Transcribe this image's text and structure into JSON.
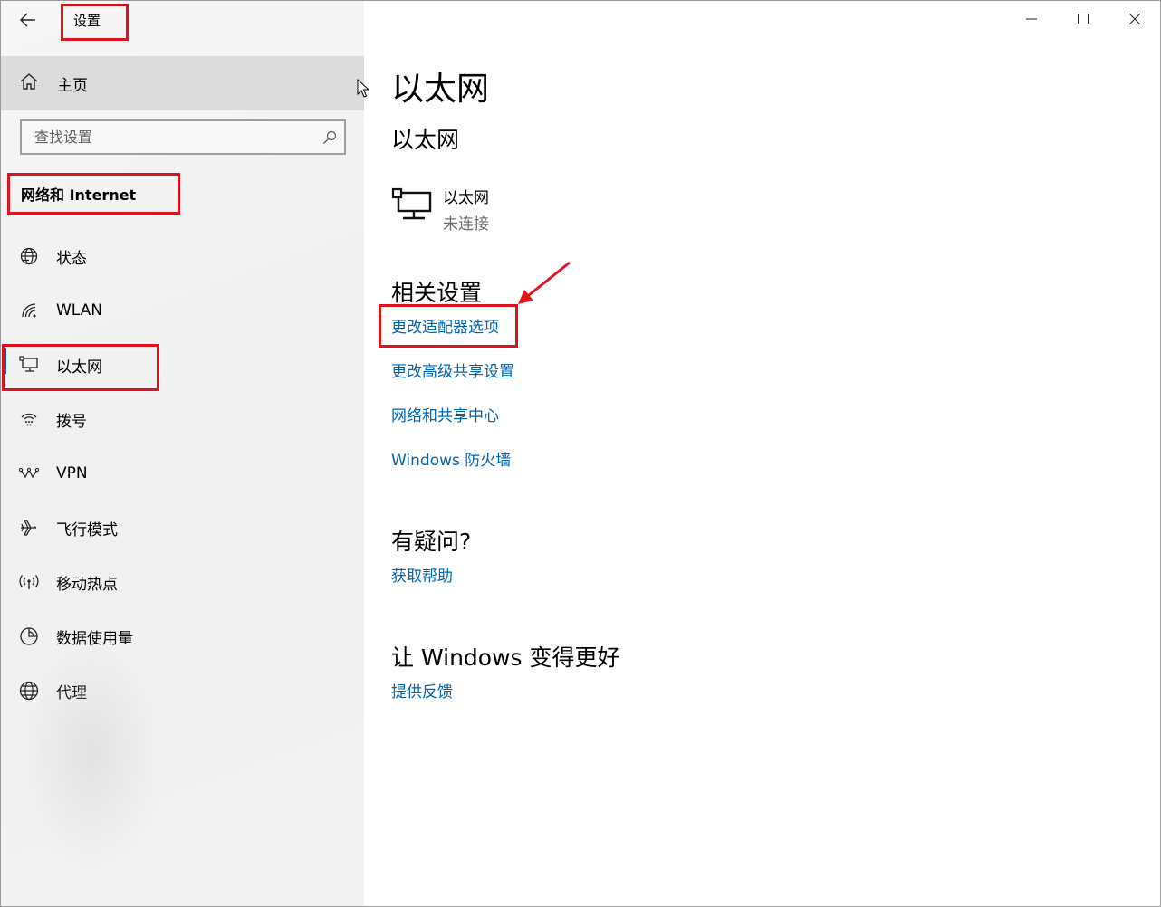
{
  "window": {
    "title": "设置",
    "controls": {
      "minimize": "minimize-icon",
      "maximize": "maximize-icon",
      "close": "close-icon"
    }
  },
  "sidebar": {
    "back_icon": "back-arrow-icon",
    "home": {
      "label": "主页",
      "icon": "home-icon"
    },
    "search": {
      "placeholder": "查找设置",
      "value": "",
      "icon": "search-icon"
    },
    "section_title": "网络和 Internet",
    "items": [
      {
        "label": "状态",
        "icon": "globe-status-icon",
        "selected": false
      },
      {
        "label": "WLAN",
        "icon": "wifi-icon",
        "selected": false
      },
      {
        "label": "以太网",
        "icon": "ethernet-icon",
        "selected": true
      },
      {
        "label": "拨号",
        "icon": "dialup-icon",
        "selected": false
      },
      {
        "label": "VPN",
        "icon": "vpn-icon",
        "selected": false
      },
      {
        "label": "飞行模式",
        "icon": "airplane-icon",
        "selected": false
      },
      {
        "label": "移动热点",
        "icon": "hotspot-icon",
        "selected": false
      },
      {
        "label": "数据使用量",
        "icon": "data-usage-icon",
        "selected": false
      },
      {
        "label": "代理",
        "icon": "globe-proxy-icon",
        "selected": false
      }
    ]
  },
  "main": {
    "title": "以太网",
    "subheading": "以太网",
    "adapter": {
      "name": "以太网",
      "status": "未连接",
      "icon": "ethernet-large-icon"
    },
    "related": {
      "heading": "相关设置",
      "links": [
        "更改适配器选项",
        "更改高级共享设置",
        "网络和共享中心",
        "Windows 防火墙"
      ]
    },
    "questions": {
      "heading": "有疑问?",
      "link": "获取帮助"
    },
    "feedback": {
      "heading": "让 Windows 变得更好",
      "link": "提供反馈"
    }
  },
  "annotations": {
    "highlight_color": "#d9141e",
    "arrow_color": "#e3161f"
  },
  "colors": {
    "accent": "#0063b1",
    "sidebar_bg": "#f2f2f2",
    "home_bg": "#dcdcdc"
  }
}
